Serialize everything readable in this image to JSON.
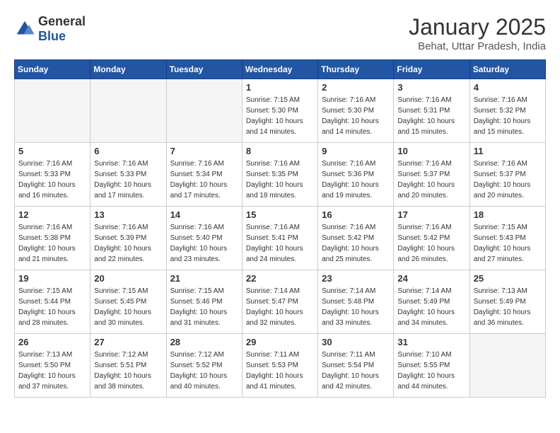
{
  "header": {
    "logo": {
      "general": "General",
      "blue": "Blue"
    },
    "title": "January 2025",
    "subtitle": "Behat, Uttar Pradesh, India"
  },
  "weekdays": [
    "Sunday",
    "Monday",
    "Tuesday",
    "Wednesday",
    "Thursday",
    "Friday",
    "Saturday"
  ],
  "weeks": [
    [
      {
        "day": "",
        "info": ""
      },
      {
        "day": "",
        "info": ""
      },
      {
        "day": "",
        "info": ""
      },
      {
        "day": "1",
        "info": "Sunrise: 7:15 AM\nSunset: 5:30 PM\nDaylight: 10 hours\nand 14 minutes."
      },
      {
        "day": "2",
        "info": "Sunrise: 7:16 AM\nSunset: 5:30 PM\nDaylight: 10 hours\nand 14 minutes."
      },
      {
        "day": "3",
        "info": "Sunrise: 7:16 AM\nSunset: 5:31 PM\nDaylight: 10 hours\nand 15 minutes."
      },
      {
        "day": "4",
        "info": "Sunrise: 7:16 AM\nSunset: 5:32 PM\nDaylight: 10 hours\nand 15 minutes."
      }
    ],
    [
      {
        "day": "5",
        "info": "Sunrise: 7:16 AM\nSunset: 5:33 PM\nDaylight: 10 hours\nand 16 minutes."
      },
      {
        "day": "6",
        "info": "Sunrise: 7:16 AM\nSunset: 5:33 PM\nDaylight: 10 hours\nand 17 minutes."
      },
      {
        "day": "7",
        "info": "Sunrise: 7:16 AM\nSunset: 5:34 PM\nDaylight: 10 hours\nand 17 minutes."
      },
      {
        "day": "8",
        "info": "Sunrise: 7:16 AM\nSunset: 5:35 PM\nDaylight: 10 hours\nand 18 minutes."
      },
      {
        "day": "9",
        "info": "Sunrise: 7:16 AM\nSunset: 5:36 PM\nDaylight: 10 hours\nand 19 minutes."
      },
      {
        "day": "10",
        "info": "Sunrise: 7:16 AM\nSunset: 5:37 PM\nDaylight: 10 hours\nand 20 minutes."
      },
      {
        "day": "11",
        "info": "Sunrise: 7:16 AM\nSunset: 5:37 PM\nDaylight: 10 hours\nand 20 minutes."
      }
    ],
    [
      {
        "day": "12",
        "info": "Sunrise: 7:16 AM\nSunset: 5:38 PM\nDaylight: 10 hours\nand 21 minutes."
      },
      {
        "day": "13",
        "info": "Sunrise: 7:16 AM\nSunset: 5:39 PM\nDaylight: 10 hours\nand 22 minutes."
      },
      {
        "day": "14",
        "info": "Sunrise: 7:16 AM\nSunset: 5:40 PM\nDaylight: 10 hours\nand 23 minutes."
      },
      {
        "day": "15",
        "info": "Sunrise: 7:16 AM\nSunset: 5:41 PM\nDaylight: 10 hours\nand 24 minutes."
      },
      {
        "day": "16",
        "info": "Sunrise: 7:16 AM\nSunset: 5:42 PM\nDaylight: 10 hours\nand 25 minutes."
      },
      {
        "day": "17",
        "info": "Sunrise: 7:16 AM\nSunset: 5:42 PM\nDaylight: 10 hours\nand 26 minutes."
      },
      {
        "day": "18",
        "info": "Sunrise: 7:15 AM\nSunset: 5:43 PM\nDaylight: 10 hours\nand 27 minutes."
      }
    ],
    [
      {
        "day": "19",
        "info": "Sunrise: 7:15 AM\nSunset: 5:44 PM\nDaylight: 10 hours\nand 28 minutes."
      },
      {
        "day": "20",
        "info": "Sunrise: 7:15 AM\nSunset: 5:45 PM\nDaylight: 10 hours\nand 30 minutes."
      },
      {
        "day": "21",
        "info": "Sunrise: 7:15 AM\nSunset: 5:46 PM\nDaylight: 10 hours\nand 31 minutes."
      },
      {
        "day": "22",
        "info": "Sunrise: 7:14 AM\nSunset: 5:47 PM\nDaylight: 10 hours\nand 32 minutes."
      },
      {
        "day": "23",
        "info": "Sunrise: 7:14 AM\nSunset: 5:48 PM\nDaylight: 10 hours\nand 33 minutes."
      },
      {
        "day": "24",
        "info": "Sunrise: 7:14 AM\nSunset: 5:49 PM\nDaylight: 10 hours\nand 34 minutes."
      },
      {
        "day": "25",
        "info": "Sunrise: 7:13 AM\nSunset: 5:49 PM\nDaylight: 10 hours\nand 36 minutes."
      }
    ],
    [
      {
        "day": "26",
        "info": "Sunrise: 7:13 AM\nSunset: 5:50 PM\nDaylight: 10 hours\nand 37 minutes."
      },
      {
        "day": "27",
        "info": "Sunrise: 7:12 AM\nSunset: 5:51 PM\nDaylight: 10 hours\nand 38 minutes."
      },
      {
        "day": "28",
        "info": "Sunrise: 7:12 AM\nSunset: 5:52 PM\nDaylight: 10 hours\nand 40 minutes."
      },
      {
        "day": "29",
        "info": "Sunrise: 7:11 AM\nSunset: 5:53 PM\nDaylight: 10 hours\nand 41 minutes."
      },
      {
        "day": "30",
        "info": "Sunrise: 7:11 AM\nSunset: 5:54 PM\nDaylight: 10 hours\nand 42 minutes."
      },
      {
        "day": "31",
        "info": "Sunrise: 7:10 AM\nSunset: 5:55 PM\nDaylight: 10 hours\nand 44 minutes."
      },
      {
        "day": "",
        "info": ""
      }
    ]
  ]
}
